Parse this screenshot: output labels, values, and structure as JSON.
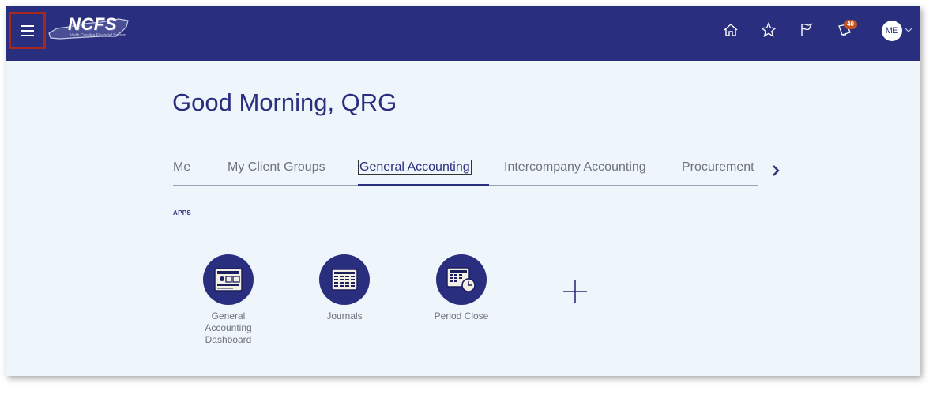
{
  "header": {
    "logo_text": "NCFS",
    "logo_subtext": "North Carolina Financial System",
    "notification_count": "40",
    "user_initials": "ME"
  },
  "icons": {
    "menu": "hamburger-icon",
    "home": "home-icon",
    "favorites": "star-icon",
    "watchlist": "flag-icon",
    "notifications": "notification-bell-icon",
    "user_menu": "chevron-down-icon",
    "tabs_next": "chevron-right-icon",
    "add": "plus-icon"
  },
  "colors": {
    "brand": "#2a2e7e",
    "highlight_box": "#a5291d",
    "badge": "#c0531e",
    "background": "#eef6fb"
  },
  "main": {
    "greeting": "Good Morning, QRG",
    "tabs": [
      {
        "label": "Me",
        "active": false
      },
      {
        "label": "My Client Groups",
        "active": false
      },
      {
        "label": "General Accounting",
        "active": true
      },
      {
        "label": "Intercompany Accounting",
        "active": false
      },
      {
        "label": "Procurement",
        "active": false
      }
    ],
    "apps_heading": "APPS",
    "apps": [
      {
        "label": "General Accounting Dashboard",
        "icon": "dashboard-icon"
      },
      {
        "label": "Journals",
        "icon": "journals-icon"
      },
      {
        "label": "Period Close",
        "icon": "period-close-icon"
      }
    ]
  }
}
